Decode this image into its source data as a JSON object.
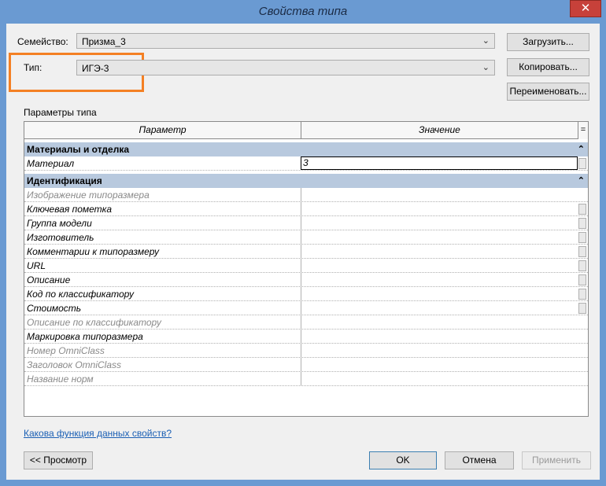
{
  "window": {
    "title": "Свойства типа",
    "close_glyph": "✕"
  },
  "family": {
    "label": "Семейство:",
    "value": "Призма_3"
  },
  "type": {
    "label": "Тип:",
    "value": "ИГЭ-3"
  },
  "buttons": {
    "load": "Загрузить...",
    "copy": "Копировать...",
    "rename": "Переименовать...",
    "preview": "<< Просмотр",
    "ok": "OK",
    "cancel": "Отмена",
    "apply": "Применить"
  },
  "params_title": "Параметры типа",
  "grid": {
    "header_param": "Параметр",
    "header_value": "Значение",
    "header_corner": "=",
    "groups": [
      {
        "name": "Материалы и отделка",
        "rows": [
          {
            "name": "Материал",
            "value": "3"
          }
        ]
      },
      {
        "name": "Идентификация",
        "rows": [
          {
            "name": "Изображение типоразмера",
            "value": ""
          },
          {
            "name": "Ключевая пометка",
            "value": ""
          },
          {
            "name": "Группа модели",
            "value": ""
          },
          {
            "name": "Изготовитель",
            "value": ""
          },
          {
            "name": "Комментарии к типоразмеру",
            "value": ""
          },
          {
            "name": "URL",
            "value": ""
          },
          {
            "name": "Описание",
            "value": ""
          },
          {
            "name": "Код по классификатору",
            "value": ""
          },
          {
            "name": "Стоимость",
            "value": ""
          },
          {
            "name": "Описание по классификатору",
            "value": ""
          },
          {
            "name": "Маркировка типоразмера",
            "value": ""
          },
          {
            "name": "Номер OmniClass",
            "value": ""
          },
          {
            "name": "Заголовок OmniClass",
            "value": ""
          },
          {
            "name": "Название норм",
            "value": ""
          }
        ]
      }
    ]
  },
  "help_link": "Какова функция данных свойств?"
}
